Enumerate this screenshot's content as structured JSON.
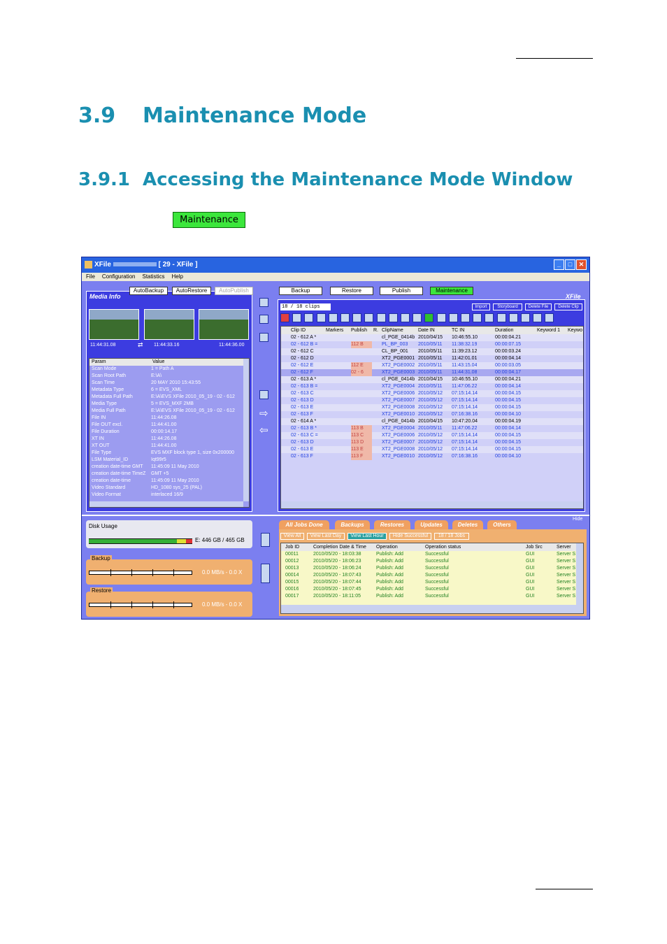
{
  "doc": {
    "section_num": "3.9",
    "section_title": "Maintenance Mode",
    "subsection_num": "3.9.1",
    "subsection_title": "Accessing the Maintenance Mode Window",
    "maintenance_button": "Maintenance"
  },
  "app": {
    "title_prefix": "XFile",
    "title_suffix": "[ 29 - XFile ]",
    "menu": [
      "File",
      "Configuration",
      "Statistics",
      "Help"
    ],
    "left_buttons": [
      "AutoBackup",
      "AutoRestore",
      "AutoPublish"
    ],
    "top_buttons": [
      "Backup",
      "Restore",
      "Publish",
      "Maintenance"
    ],
    "media_info_tab": "Media Info",
    "xfile_tab": "XFile",
    "clip_count": "18 / 18 clips",
    "clip_actions": [
      "Import",
      "Storyboard",
      "Delete File",
      "Delete Clip"
    ],
    "timecodes": [
      "11:44:31.08",
      "11:44:33.16",
      "11:44:36.00"
    ],
    "param_headers": [
      "Param",
      "Value"
    ],
    "params": [
      [
        "Scan Mode",
        "1 = Path A"
      ],
      [
        "Scan Root Path",
        "E:\\A\\"
      ],
      [
        "Scan Time",
        "20 MAY 2010 15:43:55"
      ],
      [
        "Metadata Type",
        "6 = EVS_XML"
      ],
      [
        "Metadata Full Path",
        "E:\\A\\EVS XFile 2010_05_19 - 02 - 612"
      ],
      [
        "Media Type",
        "5 = EVS_MXF 2MB"
      ],
      [
        "Media Full Path",
        "E:\\A\\EVS XFile 2010_05_19 - 02 - 612"
      ],
      [
        "File IN",
        "11:44:26.08"
      ],
      [
        "File OUT excl.",
        "11:44:41.00"
      ],
      [
        "File Duration",
        "00:00:14.17"
      ],
      [
        "XT IN",
        "11:44:26.08"
      ],
      [
        "XT OUT",
        "11:44:41.00"
      ],
      [
        "File Type",
        "EVS MXF block type 1, size 0x200000"
      ],
      [
        "LSM Material_ID",
        "Iqt99r5"
      ],
      [
        "creation date-time GMT",
        "11:45:09    11 May 2010"
      ],
      [
        "creation date-time TimeZ",
        "GMT +5"
      ],
      [
        "creation date-time",
        "11:45:09    11 May 2010"
      ],
      [
        "Video Standard",
        "HD_1080 sys_25 (PAL)"
      ],
      [
        "Video Format",
        "interlaced 16/9"
      ]
    ],
    "clip_headers": [
      "Clip ID",
      "Markers",
      "Publish",
      "R.",
      "ClipName",
      "Date IN",
      "TC IN",
      "Duration",
      "Keyword 1",
      "Keywo"
    ],
    "clips": [
      [
        "02 - 612 A *",
        "",
        "",
        "",
        "cl_PGE_0414b",
        "2010/04/15",
        "10:46:55.10",
        "00:00:04.21"
      ],
      [
        "02 - 612 B =",
        "",
        "112 B",
        "",
        "PL_BP_003",
        "2010/05/11",
        "11:38:32.19",
        "00:00:07.15"
      ],
      [
        "02 - 612 C",
        "",
        "",
        "",
        "CL_BP_001",
        "2010/05/11",
        "11:39:23.12",
        "00:00:03.24"
      ],
      [
        "02 - 612 D",
        "",
        "",
        "",
        "XT2_PGE0001",
        "2010/05/11",
        "11:42:01.01",
        "00:00:04.14"
      ],
      [
        "02 - 612 E",
        "",
        "112 E",
        "",
        "XT2_PGE0002",
        "2010/05/11",
        "11:43:15.04",
        "00:00:03.05"
      ],
      [
        "02 - 612 F",
        "",
        "02 - 6",
        "",
        "XT2_PGE0003",
        "2010/05/11",
        "11:44:31.08",
        "00:00:04.17"
      ],
      [
        "02 - 613 A *",
        "",
        "",
        "",
        "cl_PGE_0414b",
        "2010/04/15",
        "10:46:55.10",
        "00:00:04.21"
      ],
      [
        "02 - 613 B =",
        "",
        "",
        "",
        "XT2_PGE0004",
        "2010/05/11",
        "11:47:06.22",
        "00:00:04.14"
      ],
      [
        "02 - 613 C",
        "",
        "",
        "",
        "XT2_PGE0006",
        "2010/05/12",
        "07:15:14.14",
        "00:00:04.15"
      ],
      [
        "02 - 613 D",
        "",
        "",
        "",
        "XT2_PGE0007",
        "2010/05/12",
        "07:15:14.14",
        "00:00:04.15"
      ],
      [
        "02 - 613 E",
        "",
        "",
        "",
        "XT2_PGE0008",
        "2010/05/12",
        "07:15:14.14",
        "00:00:04.15"
      ],
      [
        "02 - 613 F",
        "",
        "",
        "",
        "XT2_PGE0010",
        "2010/05/12",
        "07:16:38.16",
        "00:00:04.10"
      ],
      [
        "02 - 614 A *",
        "",
        "",
        "",
        "cl_PGE_0414b",
        "2010/04/15",
        "10:47:20.04",
        "00:00:04.19"
      ],
      [
        "02 - 613 B *",
        "",
        "113 B",
        "",
        "XT2_PGE0004",
        "2010/05/11",
        "11:47:06.22",
        "00:00:04.14"
      ],
      [
        "02 - 613 C =",
        "",
        "113 C",
        "",
        "XT2_PGE0006",
        "2010/05/12",
        "07:15:14.14",
        "00:00:04.15"
      ],
      [
        "02 - 613 D",
        "",
        "113 D",
        "",
        "XT2_PGE0007",
        "2010/05/12",
        "07:15:14.14",
        "00:00:04.15"
      ],
      [
        "02 - 613 E",
        "",
        "113 E",
        "",
        "XT2_PGE0008",
        "2010/05/12",
        "07:15:14.14",
        "00:00:04.15"
      ],
      [
        "02 - 613 F",
        "",
        "113 F",
        "",
        "XT2_PGE0010",
        "2010/05/12",
        "07:16:38.16",
        "00:00:04.10"
      ]
    ],
    "disk_usage_label": "Disk Usage",
    "disk_usage_value": "E: 446 GB / 465 GB",
    "backup_label": "Backup",
    "backup_rate": "0.0 MB/s - 0.0 X",
    "restore_label": "Restore",
    "restore_rate": "0.0 MB/s - 0.0 X",
    "hide_label": "Hide",
    "job_tabs": [
      "All Jobs Done",
      "Backups",
      "Restores",
      "Updates",
      "Deletes",
      "Others"
    ],
    "job_filters": [
      "View All",
      "View Last Day",
      "View Last Hour",
      "Hide Successful",
      "18 / 18 Jobs"
    ],
    "job_headers": [
      "Job ID",
      "Completion Date & Time",
      "Operation",
      "Operation status",
      "Job Src",
      "Server"
    ],
    "jobs": [
      [
        "00011",
        "2010/05/20 - 18:03:38",
        "Publish: Add",
        "Successful",
        "GUI",
        "Server S"
      ],
      [
        "00012",
        "2010/05/20 - 18:06:23",
        "Publish: Add",
        "Successful",
        "GUI",
        "Server S"
      ],
      [
        "00013",
        "2010/05/20 - 18:06:24",
        "Publish: Add",
        "Successful",
        "GUI",
        "Server S"
      ],
      [
        "00014",
        "2010/05/20 - 18:07:43",
        "Publish: Add",
        "Successful",
        "GUI",
        "Server S"
      ],
      [
        "00015",
        "2010/05/20 - 18:07:44",
        "Publish: Add",
        "Successful",
        "GUI",
        "Server S"
      ],
      [
        "00016",
        "2010/05/20 - 18:07:45",
        "Publish: Add",
        "Successful",
        "GUI",
        "Server S"
      ],
      [
        "00017",
        "2010/05/20 - 18:11:05",
        "Publish: Add",
        "Successful",
        "GUI",
        "Server S"
      ]
    ]
  }
}
